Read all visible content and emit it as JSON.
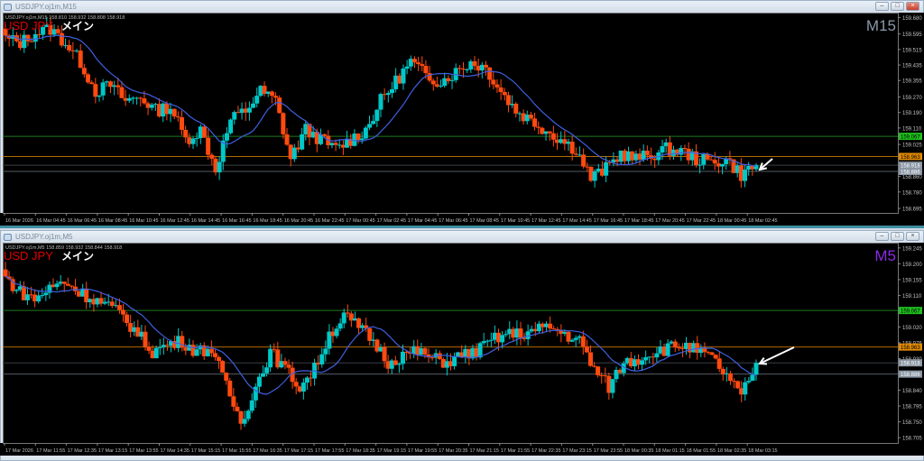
{
  "windows": [
    {
      "title": "USDJPY.oj1m,M15",
      "symbol_line": "USDJPY.oj1m,M15",
      "ohlc": "158.810 158.932 158.808 158.918",
      "label_symbol": "USD JPY",
      "label_main": "メイン",
      "timeframe": "M15",
      "timeframe_color": "#8a98a8",
      "y_range": [
        158.672,
        159.705
      ],
      "price_ticks": [
        "159.680",
        "159.595",
        "159.515",
        "159.435",
        "159.355",
        "159.270",
        "159.190",
        "159.110",
        "159.025",
        "158.860",
        "158.780",
        "158.695"
      ],
      "levels": [
        {
          "price": "159.067",
          "color": "#1fbf1f",
          "line": "#1e7a1e"
        },
        {
          "price": "158.963",
          "color": "#e08a00",
          "line": "#b06a00"
        },
        {
          "price": "158.918",
          "color": "#8a96a4",
          "line": "#3a3f45"
        },
        {
          "price": "158.886",
          "color": "#8a96a4",
          "line": "#555b62"
        }
      ],
      "closes": [
        159.57,
        159.55,
        159.6,
        159.62,
        159.55,
        159.45,
        159.3,
        159.33,
        159.25,
        159.27,
        159.2,
        159.22,
        159.05,
        159.1,
        158.9,
        159.15,
        159.2,
        159.3,
        159.25,
        158.95,
        159.1,
        159.05,
        159.0,
        159.05,
        159.1,
        159.25,
        159.35,
        159.45,
        159.38,
        159.35,
        159.4,
        159.45,
        159.42,
        159.3,
        159.2,
        159.15,
        159.1,
        159.05,
        159.0,
        158.85,
        158.9,
        158.98,
        158.95,
        158.97,
        159.0,
        158.99,
        158.95,
        158.93,
        158.95,
        158.87,
        158.918
      ],
      "times": [
        "16 Mar 2026",
        "16 Mar 04:45",
        "16 Mar 06:45",
        "16 Mar 08:45",
        "16 Mar 10:45",
        "16 Mar 12:45",
        "16 Mar 14:45",
        "16 Mar 16:45",
        "16 Mar 18:45",
        "16 Mar 20:45",
        "16 Mar 22:45",
        "17 Mar 00:45",
        "17 Mar 02:45",
        "17 Mar 04:45",
        "17 Mar 06:45",
        "17 Mar 08:45",
        "17 Mar 10:45",
        "17 Mar 12:45",
        "17 Mar 14:45",
        "17 Mar 16:45",
        "17 Mar 18:45",
        "17 Mar 20:45",
        "17 Mar 22:45",
        "18 Mar 00:45",
        "18 Mar 02:45"
      ]
    },
    {
      "title": "USDJPY.oj1m,M5",
      "symbol_line": "USDJPY.oj1m,M5",
      "ohlc": "158.859 158.932 158.844 158.918",
      "label_symbol": "USD JPY",
      "label_main": "メイン",
      "timeframe": "M5",
      "timeframe_color": "#8a2be2",
      "y_range": [
        158.69,
        159.26
      ],
      "price_ticks": [
        "159.245",
        "159.200",
        "159.155",
        "159.110",
        "159.020",
        "158.975",
        "158.930",
        "158.840",
        "158.795",
        "158.750",
        "158.705"
      ],
      "levels": [
        {
          "price": "159.067",
          "color": "#1fbf1f",
          "line": "#1e7a1e"
        },
        {
          "price": "158.963",
          "color": "#e08a00",
          "line": "#b06a00"
        },
        {
          "price": "158.918",
          "color": "#8a96a4",
          "line": "#3a3f45"
        },
        {
          "price": "158.886",
          "color": "#8a96a4",
          "line": "#555b62"
        }
      ],
      "closes": [
        159.16,
        159.12,
        159.1,
        159.13,
        159.15,
        159.12,
        159.1,
        159.08,
        159.05,
        159.0,
        158.95,
        158.97,
        158.98,
        158.95,
        158.96,
        158.85,
        158.75,
        158.85,
        158.95,
        158.9,
        158.85,
        158.9,
        159.0,
        159.05,
        159.02,
        158.98,
        158.92,
        158.94,
        158.95,
        158.93,
        158.92,
        158.94,
        158.95,
        158.98,
        159.0,
        159.0,
        159.01,
        159.02,
        159.0,
        158.98,
        158.9,
        158.85,
        158.92,
        158.93,
        158.95,
        158.96,
        158.97,
        158.95,
        158.93,
        158.88,
        158.82,
        158.918
      ],
      "times": [
        "17 Mar 2026",
        "17 Mar 11:55",
        "17 Mar 12:35",
        "17 Mar 13:15",
        "17 Mar 13:55",
        "17 Mar 14:35",
        "17 Mar 15:15",
        "17 Mar 15:55",
        "17 Mar 16:35",
        "17 Mar 17:15",
        "17 Mar 17:55",
        "17 Mar 18:35",
        "17 Mar 19:15",
        "17 Mar 19:55",
        "17 Mar 20:35",
        "17 Mar 21:15",
        "17 Mar 21:55",
        "17 Mar 22:35",
        "17 Mar 23:15",
        "17 Mar 23:55",
        "18 Mar 00:35",
        "18 Mar 01:15",
        "18 Mar 01:55",
        "18 Mar 02:35",
        "18 Mar 03:15"
      ]
    }
  ],
  "colors": {
    "bull": "#00c8c8",
    "bear": "#ff4a10",
    "ma": "#3f5fe0",
    "background": "#000000",
    "axis_text": "#c0c0c0"
  },
  "icons": {
    "arrow": "arrow-pointing-down-left",
    "minimize": "minimize-icon",
    "maximize": "maximize-icon",
    "close": "close-icon"
  }
}
